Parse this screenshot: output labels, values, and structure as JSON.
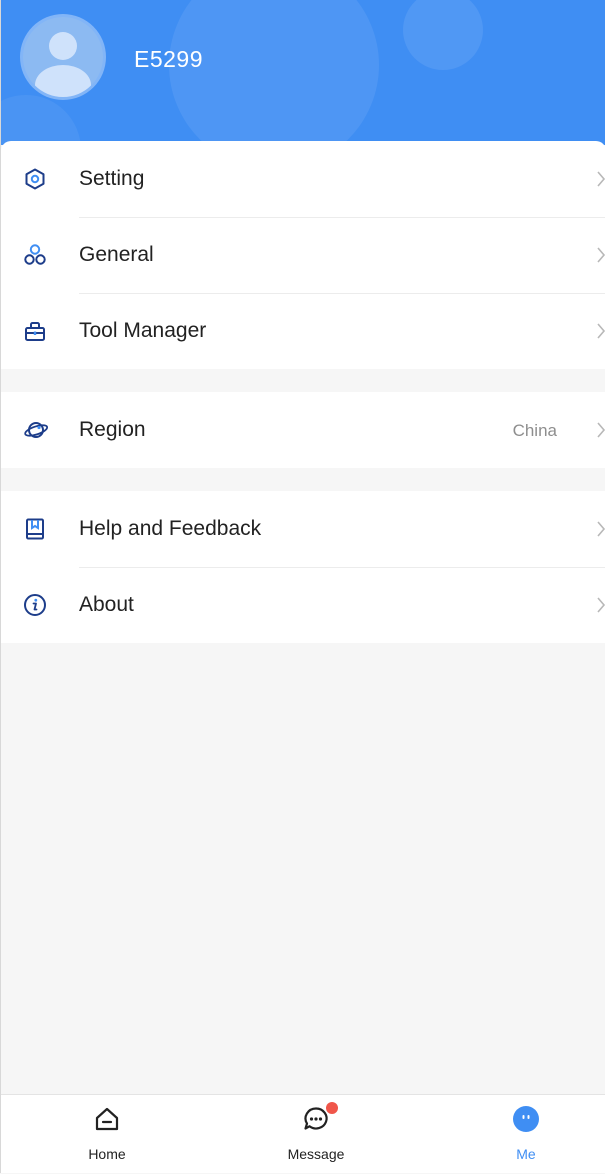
{
  "profile": {
    "username": "E5299"
  },
  "menu": {
    "setting": {
      "label": "Setting",
      "icon": "settings-hexagon-icon"
    },
    "general": {
      "label": "General",
      "icon": "general-circles-icon"
    },
    "tool_manager": {
      "label": "Tool Manager",
      "icon": "toolbox-icon"
    },
    "region": {
      "label": "Region",
      "value": "China",
      "icon": "planet-icon"
    },
    "help": {
      "label": "Help and Feedback",
      "icon": "book-icon"
    },
    "about": {
      "label": "About",
      "icon": "info-icon"
    }
  },
  "tabbar": {
    "home": {
      "label": "Home",
      "icon": "home-icon"
    },
    "message": {
      "label": "Message",
      "icon": "chat-bubble-icon",
      "has_badge": true
    },
    "me": {
      "label": "Me",
      "icon": "me-face-icon",
      "active": true
    }
  },
  "colors": {
    "header_blue": "#3f8ef3",
    "accent_blue": "#3f8ef3",
    "badge_red": "#f0564a",
    "background": "#f6f6f6"
  }
}
